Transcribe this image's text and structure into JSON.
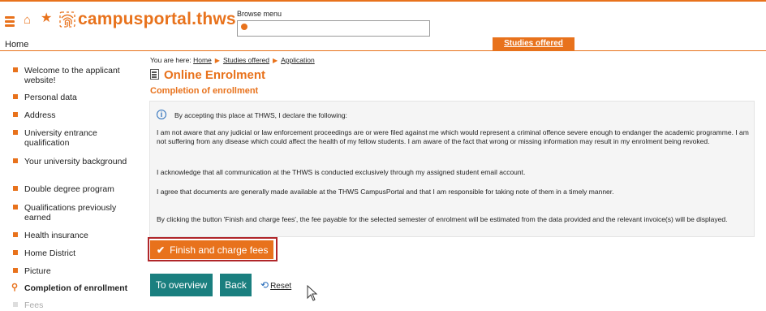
{
  "header": {
    "logo_text": "campusportal.thws",
    "browse_label": "Browse menu",
    "browse_value": ""
  },
  "menubar": {
    "home": "Home",
    "studies_offered": "Studies offered"
  },
  "sidebar": {
    "items": [
      {
        "label": "Welcome to the applicant website!"
      },
      {
        "label": "Personal data"
      },
      {
        "label": "Address"
      },
      {
        "label": "University entrance qualification"
      },
      {
        "label": "Your university background"
      },
      {
        "label": "Double degree program"
      },
      {
        "label": "Qualifications previously earned"
      },
      {
        "label": "Health insurance"
      },
      {
        "label": "Home District"
      },
      {
        "label": "Picture"
      },
      {
        "label": "Completion of enrollment"
      },
      {
        "label": "Fees"
      }
    ]
  },
  "breadcrumb": {
    "prefix": "You are here:",
    "items": [
      "Home",
      "Studies offered",
      "Application"
    ]
  },
  "main": {
    "title": "Online Enrolment",
    "subtitle": "Completion of enrollment",
    "info": {
      "intro": "By accepting this place at THWS, I declare the following:",
      "p1": "I am not aware that any judicial or law enforcement proceedings are or were filed against me which would represent a criminal offence severe enough to endanger the academic programme. I am not suffering from any disease which could affect the health of my fellow students. I am aware of the fact that wrong or missing information may result in my enrolment being revoked.",
      "p2": "I acknowledge that all communication at the THWS is conducted exclusively through my assigned student email account.",
      "p3": "I agree that documents are generally made available at the THWS CampusPortal and that I am responsible for taking note of them in a timely manner.",
      "p4": "By clicking the button 'Finish and charge fees', the fee payable for the selected semester of enrolment will be estimated from the data provided and the relevant invoice(s) will be displayed."
    },
    "finish_button": "Finish and charge fees",
    "overview_button": "To overview",
    "back_button": "Back",
    "reset_link": "Reset"
  },
  "colors": {
    "accent": "#e8721c",
    "teal": "#1a7f7f",
    "highlight_border": "#b0262a",
    "info_blue": "#2a6ebb"
  }
}
